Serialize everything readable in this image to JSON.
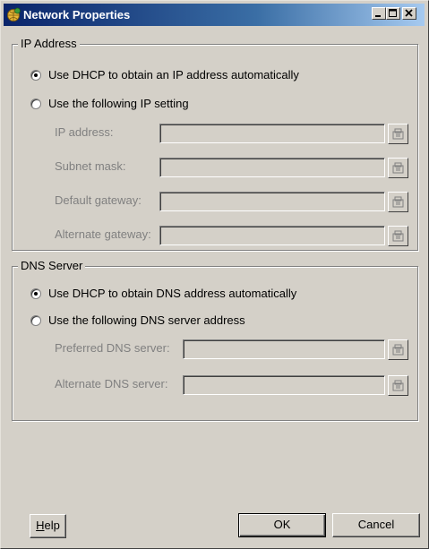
{
  "window": {
    "title": "Network Properties",
    "title_icon": "network-globe-icon"
  },
  "titlebar_buttons": {
    "minimize": "_",
    "maximize": "□",
    "close": "×"
  },
  "ip_group": {
    "legend": "IP Address",
    "radio_dhcp": {
      "label": "Use DHCP to obtain an IP address automatically",
      "checked": true
    },
    "radio_manual": {
      "label": "Use the following IP setting",
      "checked": false
    },
    "fields": [
      {
        "label": "IP address:",
        "value": ""
      },
      {
        "label": "Subnet mask:",
        "value": ""
      },
      {
        "label": "Default gateway:",
        "value": ""
      },
      {
        "label": "Alternate gateway:",
        "value": ""
      }
    ]
  },
  "dns_group": {
    "legend": "DNS Server",
    "radio_dhcp": {
      "label": "Use DHCP to obtain DNS address automatically",
      "checked": true
    },
    "radio_manual": {
      "label": "Use the following DNS server address",
      "checked": false
    },
    "fields": [
      {
        "label": "Preferred DNS server:",
        "value": ""
      },
      {
        "label": "Alternate DNS server:",
        "value": ""
      }
    ]
  },
  "buttons": {
    "help_accel": "H",
    "help_rest": "elp",
    "ok": "OK",
    "cancel": "Cancel"
  },
  "colors": {
    "dialog_bg": "#d4d0c8",
    "titlebar_start": "#0a246a",
    "titlebar_end": "#a6caf0",
    "disabled_text": "#808080"
  },
  "icons": {
    "ip_picker": "network-card-icon"
  }
}
